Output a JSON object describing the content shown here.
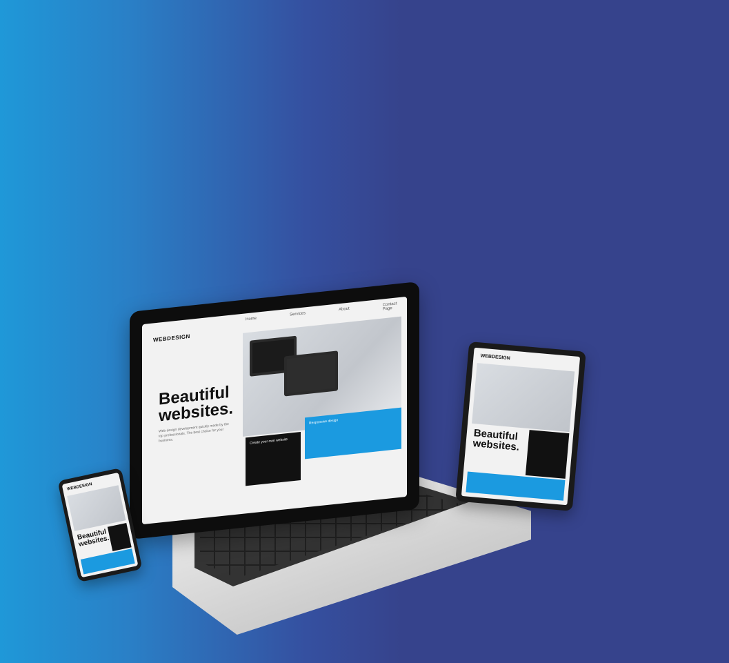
{
  "laptop": {
    "brand": "WEBDESIGN",
    "nav": [
      "Home",
      "Services",
      "About",
      "Contact Page"
    ],
    "hero_title_line1": "Beautiful",
    "hero_title_line2": "websites.",
    "hero_sub": "Web design development quickly made by the top professionals. The best choice for your business.",
    "dark_card_text": "Create your own website",
    "blue_card_text": "Responsive design"
  },
  "tablet": {
    "brand": "WEBDESIGN",
    "title_line1": "Beautiful",
    "title_line2": "websites."
  },
  "phone": {
    "brand": "WEBDESIGN",
    "title_line1": "Beautiful",
    "title_line2": "websites."
  }
}
